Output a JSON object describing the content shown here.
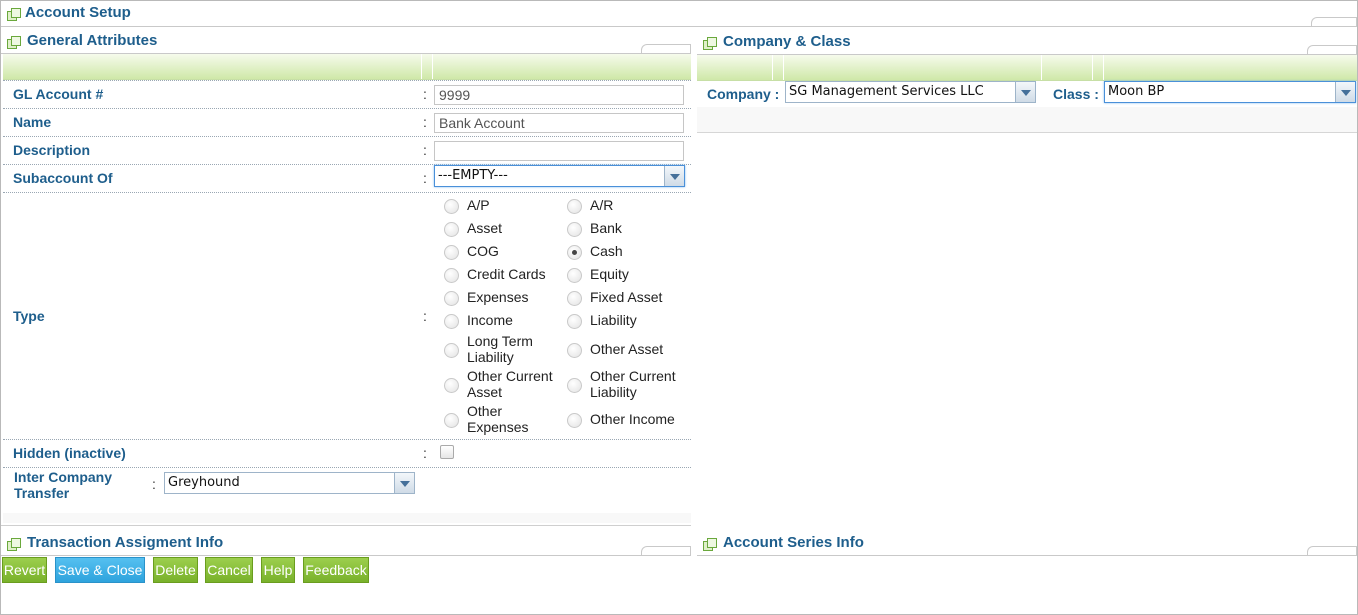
{
  "window": {
    "title": "Account Setup"
  },
  "sections": {
    "general": "General Attributes",
    "company_class": "Company & Class",
    "transaction": "Transaction Assigment Info",
    "series": "Account Series Info"
  },
  "form": {
    "gl_account": {
      "label": "GL Account #",
      "value": "9999"
    },
    "name": {
      "label": "Name",
      "value": "Bank Account"
    },
    "description": {
      "label": "Description",
      "value": ""
    },
    "subaccount": {
      "label": "Subaccount Of",
      "value": "---EMPTY---"
    },
    "type": {
      "label": "Type",
      "selected": "Cash",
      "options": [
        {
          "label": "A/P",
          "checked": false
        },
        {
          "label": "A/R",
          "checked": false
        },
        {
          "label": "Asset",
          "checked": false
        },
        {
          "label": "Bank",
          "checked": false
        },
        {
          "label": "COG",
          "checked": false
        },
        {
          "label": "Cash",
          "checked": true
        },
        {
          "label": "Credit Cards",
          "checked": false
        },
        {
          "label": "Equity",
          "checked": false
        },
        {
          "label": "Expenses",
          "checked": false
        },
        {
          "label": "Fixed Asset",
          "checked": false
        },
        {
          "label": "Income",
          "checked": false
        },
        {
          "label": "Liability",
          "checked": false
        },
        {
          "label": "Long Term Liability",
          "checked": false
        },
        {
          "label": "Other Asset",
          "checked": false
        },
        {
          "label": "Other Current Asset",
          "checked": false
        },
        {
          "label": "Other Current Liability",
          "checked": false
        },
        {
          "label": "Other Expenses",
          "checked": false
        },
        {
          "label": "Other Income",
          "checked": false
        }
      ]
    },
    "hidden": {
      "label": "Hidden (inactive)",
      "checked": false
    },
    "inter_company": {
      "label": "Inter Company Transfer",
      "value": "Greyhound"
    },
    "colon": ":"
  },
  "company_class": {
    "company": {
      "label": "Company :",
      "value": "SG Management Services LLC"
    },
    "class": {
      "label": "Class :",
      "value": "Moon BP"
    }
  },
  "actions": {
    "revert": "Revert",
    "save_close": "Save & Close",
    "delete": "Delete",
    "cancel": "Cancel",
    "help": "Help",
    "feedback": "Feedback"
  },
  "colors": {
    "heading": "#1e5e8c",
    "button_green": "#8cc63f",
    "button_blue": "#3aaee6",
    "band_green": "#cfe8a8"
  },
  "icons": {
    "section": "window-stack-icon",
    "dropdown": "chevron-down-icon"
  }
}
